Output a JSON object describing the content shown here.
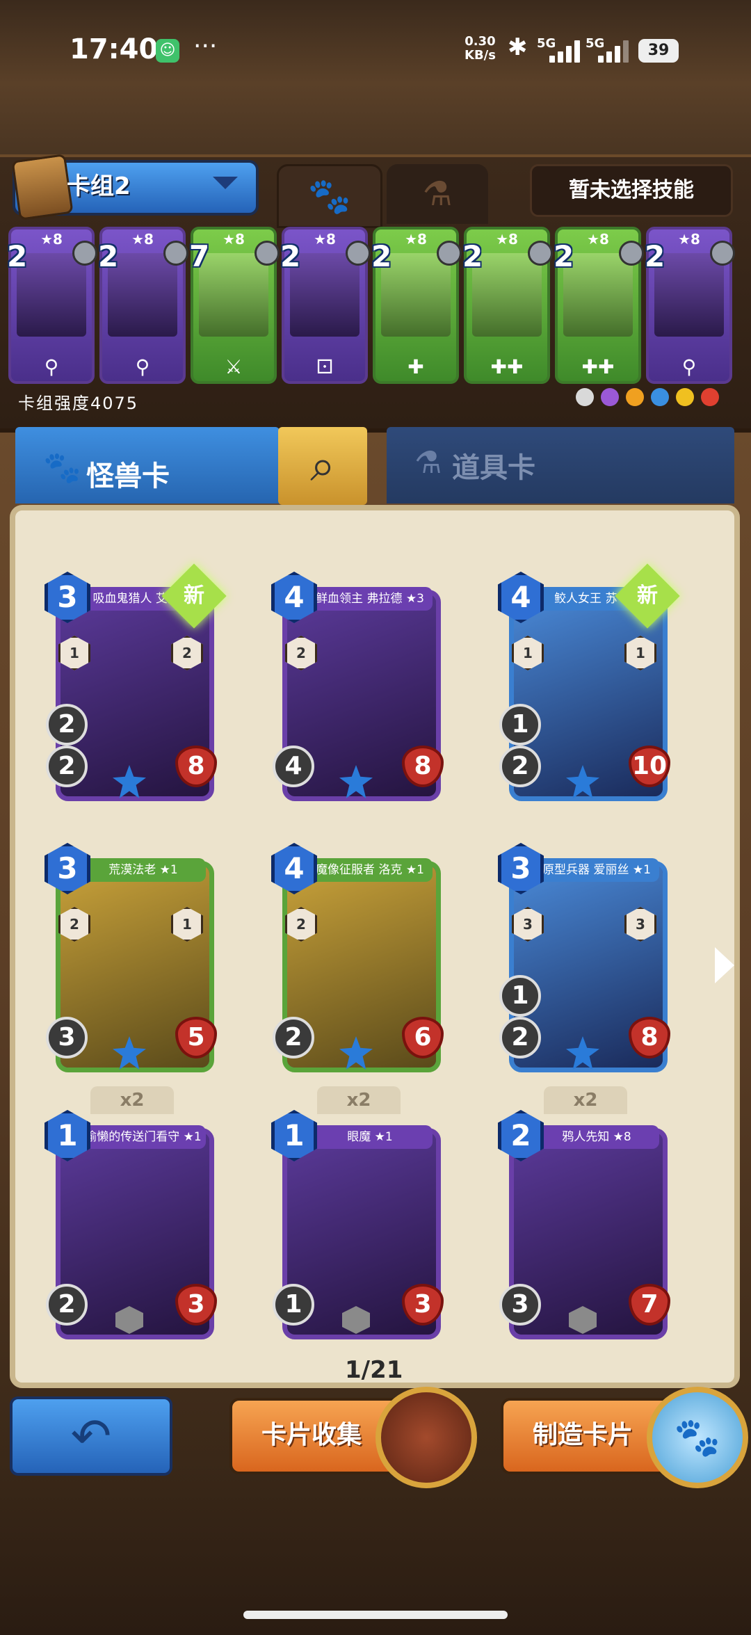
{
  "status_bar": {
    "time": "17:40",
    "dots": "···",
    "net_speed": "0.30\nKB/s",
    "sig1": "5G",
    "sig2": "5G",
    "battery": "39"
  },
  "deck": {
    "name": "卡组2",
    "skill_button": "暂未选择技能",
    "power": "卡组强度4075",
    "cards": [
      {
        "cost": "2",
        "star": "★8",
        "color": "purple",
        "bottom": "⚲"
      },
      {
        "cost": "2",
        "star": "★8",
        "color": "purple",
        "bottom": "⚲"
      },
      {
        "cost": "7",
        "star": "★8",
        "color": "green",
        "bottom": "⚔"
      },
      {
        "cost": "2",
        "star": "★8",
        "color": "purple",
        "bottom": "⚀"
      },
      {
        "cost": "2",
        "star": "★8",
        "color": "green",
        "bottom": "✚"
      },
      {
        "cost": "2",
        "star": "★8",
        "color": "green",
        "bottom": "✚✚"
      },
      {
        "cost": "2",
        "star": "★8",
        "color": "green",
        "bottom": "✚✚"
      },
      {
        "cost": "2",
        "star": "★8",
        "color": "purple",
        "bottom": "⚲"
      }
    ],
    "element_colors": [
      "#d9d9d9",
      "#9b59d6",
      "#f0a020",
      "#3a8fe0",
      "#f0c020",
      "#e04030"
    ]
  },
  "tabs": {
    "monster": "怪兽卡",
    "items": "道具卡"
  },
  "cards": [
    {
      "name": "吸血鬼猎人 艾斯 ★",
      "cost": "3",
      "atk": "2",
      "extra": "2",
      "hp": "8",
      "color": "purple",
      "new": "新",
      "skill_left": "1",
      "skill_right": "2",
      "gem": "star",
      "count": ""
    },
    {
      "name": "鲜血领主 弗拉德 ★3",
      "cost": "4",
      "atk": "4",
      "extra": "",
      "hp": "8",
      "color": "purple",
      "new": "",
      "skill_left": "2",
      "skill_right": "",
      "gem": "star",
      "count": ""
    },
    {
      "name": "鲛人女王 苏 ★1",
      "cost": "4",
      "atk": "2",
      "extra": "1",
      "hp": "10",
      "color": "blue",
      "new": "新",
      "skill_left": "1",
      "skill_right": "1",
      "gem": "star",
      "count": ""
    },
    {
      "name": "荒漠法老 ★1",
      "cost": "3",
      "atk": "3",
      "extra": "",
      "hp": "5",
      "color": "green",
      "new": "",
      "skill_left": "2",
      "skill_right": "1",
      "gem": "star",
      "count": ""
    },
    {
      "name": "魔像征服者 洛克 ★1",
      "cost": "4",
      "atk": "2",
      "extra": "",
      "hp": "6",
      "color": "green",
      "new": "",
      "skill_left": "2",
      "skill_right": "",
      "gem": "star",
      "count": ""
    },
    {
      "name": "原型兵器 爱丽丝 ★1",
      "cost": "3",
      "atk": "2",
      "extra": "1",
      "hp": "8",
      "color": "blue",
      "new": "",
      "skill_left": "3",
      "skill_right": "3",
      "gem": "star",
      "count": ""
    },
    {
      "name": "偷懒的传送门看守 ★1",
      "cost": "1",
      "atk": "2",
      "extra": "",
      "hp": "3",
      "color": "purple",
      "new": "",
      "skill_left": "",
      "skill_right": "",
      "gem": "gray",
      "count": "x2"
    },
    {
      "name": "眼魔 ★1",
      "cost": "1",
      "atk": "1",
      "extra": "",
      "hp": "3",
      "color": "purple",
      "new": "",
      "skill_left": "",
      "skill_right": "",
      "gem": "gray",
      "count": "x2"
    },
    {
      "name": "鸦人先知 ★8",
      "cost": "2",
      "atk": "3",
      "extra": "",
      "hp": "7",
      "color": "purple",
      "new": "",
      "skill_left": "",
      "skill_right": "",
      "gem": "gray",
      "count": "x2"
    }
  ],
  "page_indicator": "1/21",
  "buttons": {
    "back": "↶",
    "collect": "卡片收集",
    "craft": "制造卡片"
  }
}
